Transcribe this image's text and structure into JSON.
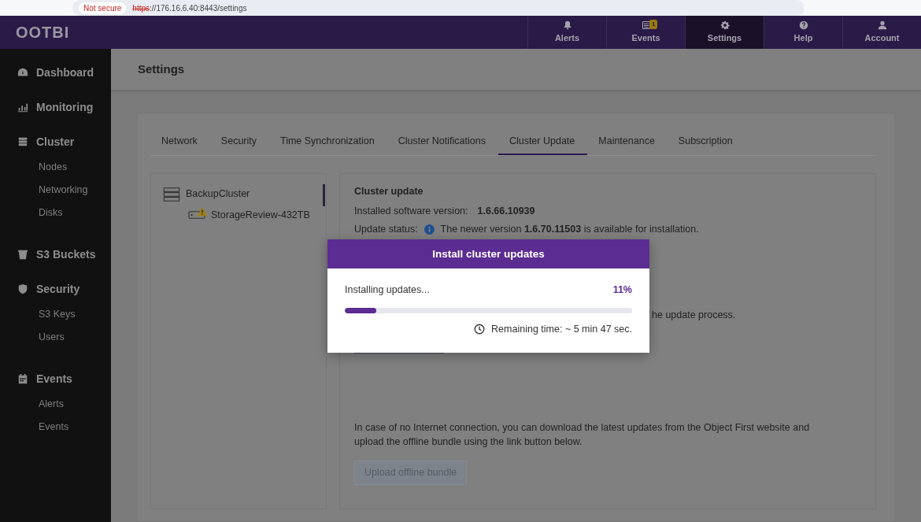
{
  "browser": {
    "security_label": "Not secure",
    "url_scheme": "https",
    "url_rest": "://176.16.6.40:8443/settings"
  },
  "app": {
    "logo": "OOTBI",
    "nav": [
      {
        "label": "Alerts",
        "selected": false
      },
      {
        "label": "Events",
        "selected": false,
        "badge": "1"
      },
      {
        "label": "Settings",
        "selected": true
      },
      {
        "label": "Help",
        "selected": false
      },
      {
        "label": "Account",
        "selected": false
      }
    ]
  },
  "sidebar": [
    {
      "label": "Dashboard"
    },
    {
      "label": "Monitoring"
    },
    {
      "label": "Cluster",
      "children": [
        "Nodes",
        "Networking",
        "Disks"
      ]
    },
    {
      "label": "S3 Buckets"
    },
    {
      "label": "Security",
      "children": [
        "S3 Keys",
        "Users"
      ]
    },
    {
      "label": "Events",
      "children": [
        "Alerts",
        "Events"
      ]
    }
  ],
  "page_title": "Settings",
  "tabs": [
    {
      "label": "Network",
      "selected": false
    },
    {
      "label": "Security",
      "selected": false
    },
    {
      "label": "Time Synchronization",
      "selected": false
    },
    {
      "label": "Cluster Notifications",
      "selected": false
    },
    {
      "label": "Cluster Update",
      "selected": true
    },
    {
      "label": "Maintenance",
      "selected": false
    },
    {
      "label": "Subscription",
      "selected": false
    }
  ],
  "tree": {
    "label": "BackupCluster",
    "children": [
      {
        "label": "StorageReview-432TB",
        "warning": true
      }
    ]
  },
  "cluster_update": {
    "heading": "Cluster update",
    "installed_label": "Installed software version:",
    "installed_value": "1.6.66.10939",
    "status_label": "Update status:",
    "status_text": "The newer version **1.6.70.11503** is available for installation.",
    "partial_text": "he update process.",
    "offline_text": "In case of no Internet connection, you can download the latest updates from the Object First website and upload the offline bundle using the link button below.",
    "upload_button": {
      "label": "Upload offline bundle",
      "disabled": true
    }
  },
  "modal": {
    "title": "Install cluster updates",
    "status_text": "Installing updates...",
    "percent": "11%",
    "level": 0.11,
    "remaining": "Remaining time: ~ 5 min 47 sec."
  }
}
